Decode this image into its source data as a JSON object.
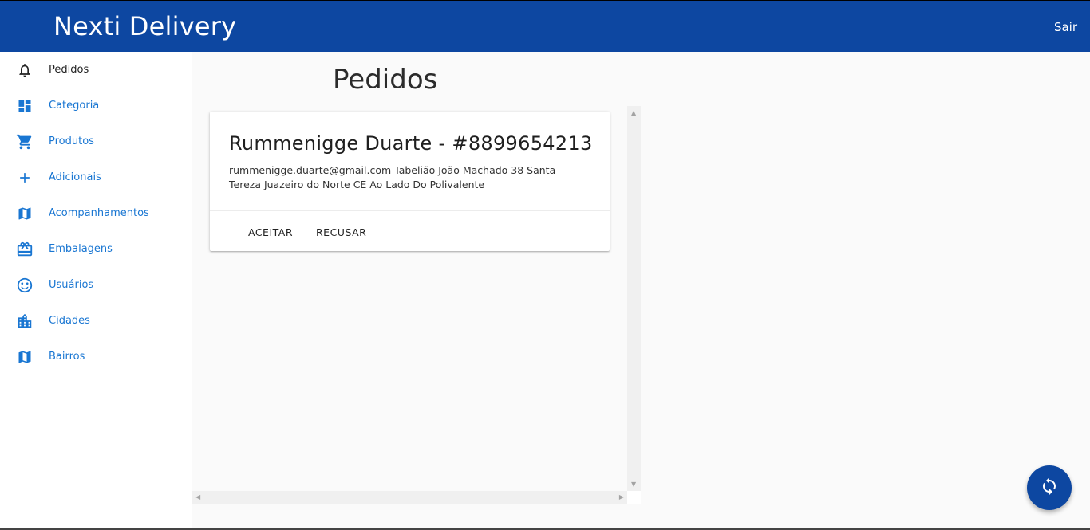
{
  "app": {
    "title": "Nexti Delivery",
    "logout_label": "Sair"
  },
  "colors": {
    "primary": "#0d47a1",
    "link": "#1976d2"
  },
  "sidebar": {
    "items": [
      {
        "label": "Pedidos",
        "icon": "bell-icon",
        "active": true
      },
      {
        "label": "Categoria",
        "icon": "dashboard-icon"
      },
      {
        "label": "Produtos",
        "icon": "shopping-cart-icon"
      },
      {
        "label": "Adicionais",
        "icon": "plus-icon"
      },
      {
        "label": "Acompanhamentos",
        "icon": "map-icon"
      },
      {
        "label": "Embalagens",
        "icon": "gift-box-icon"
      },
      {
        "label": "Usuários",
        "icon": "smiley-icon"
      },
      {
        "label": "Cidades",
        "icon": "city-icon"
      },
      {
        "label": "Bairros",
        "icon": "map-icon"
      }
    ]
  },
  "main": {
    "title": "Pedidos",
    "orders": [
      {
        "title": "Rummenigge Duarte - #8899654213",
        "details": "rummenigge.duarte@gmail.com Tabelião João Machado 38 Santa Tereza Juazeiro do Norte CE Ao Lado Do Polivalente",
        "accept_label": "ACEITAR",
        "reject_label": "RECUSAR"
      }
    ]
  },
  "fab": {
    "icon": "refresh-icon"
  }
}
